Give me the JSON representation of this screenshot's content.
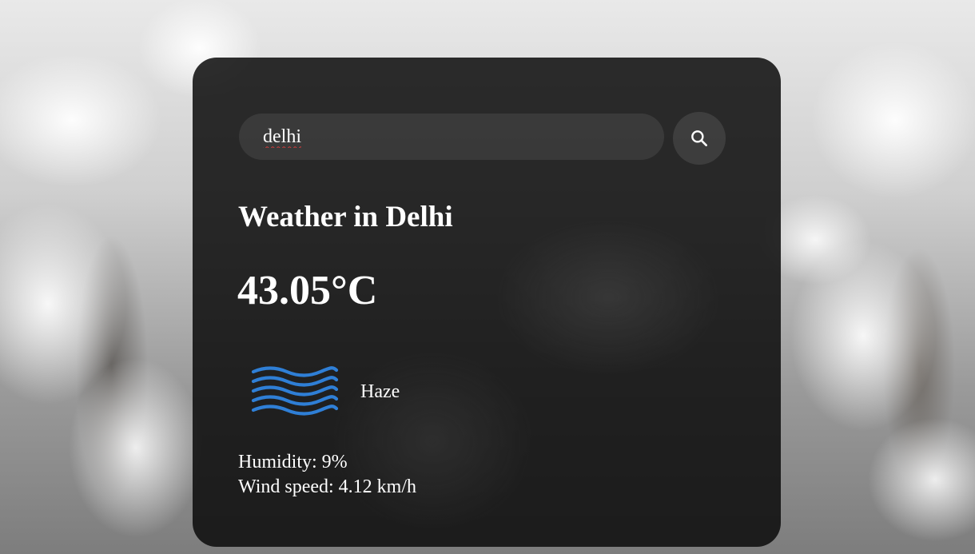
{
  "search": {
    "value": "delhi",
    "placeholder": "Search"
  },
  "weather": {
    "title": "Weather in Delhi",
    "temperature": "43.05°C",
    "condition": "Haze",
    "condition_icon": "haze-icon",
    "humidity": "Humidity: 9%",
    "wind": "Wind speed: 4.12 km/h"
  },
  "colors": {
    "icon_blue": "#2f7fd6",
    "text": "#ffffff",
    "card_bg": "#0c0c0c"
  }
}
